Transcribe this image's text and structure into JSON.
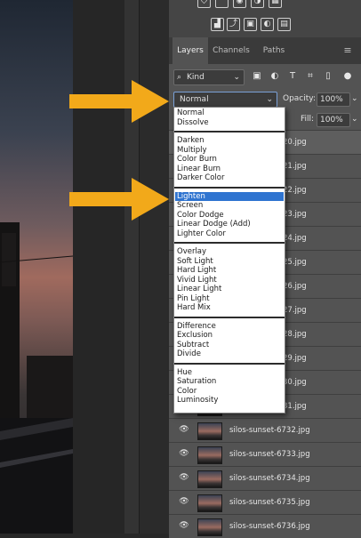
{
  "toolbar_icons": [
    {
      "name": "shape-icon",
      "glyph": "◇"
    },
    {
      "name": "warp-icon",
      "glyph": "⌒"
    },
    {
      "name": "camera-icon",
      "glyph": "◉"
    },
    {
      "name": "balance-icon",
      "glyph": "◑"
    },
    {
      "name": "grid-icon",
      "glyph": "▦"
    },
    {
      "name": "levels-icon",
      "glyph": "▟"
    },
    {
      "name": "curves-icon",
      "glyph": "⤴"
    },
    {
      "name": "mask-icon",
      "glyph": "▣"
    },
    {
      "name": "half-circle-icon",
      "glyph": "◐"
    },
    {
      "name": "table-icon",
      "glyph": "▤"
    }
  ],
  "tabs": {
    "layers": "Layers",
    "channels": "Channels",
    "paths": "Paths"
  },
  "filter": {
    "kind_label": "Kind",
    "search_glyph": "⌕",
    "chevron": "⌄",
    "icons": [
      {
        "name": "image-filter-icon",
        "glyph": "▣"
      },
      {
        "name": "adjustment-filter-icon",
        "glyph": "◐"
      },
      {
        "name": "type-filter-icon",
        "glyph": "T"
      },
      {
        "name": "shape-filter-icon",
        "glyph": "⌗"
      },
      {
        "name": "smart-object-filter-icon",
        "glyph": "▯"
      }
    ]
  },
  "blend": {
    "value": "Normal",
    "opacity_label": "Opacity:",
    "opacity_value": "100%",
    "fill_label": "Fill:",
    "fill_value": "100%"
  },
  "blend_groups": [
    [
      "Normal",
      "Dissolve"
    ],
    [
      "Darken",
      "Multiply",
      "Color Burn",
      "Linear Burn",
      "Darker Color"
    ],
    [
      "Lighten",
      "Screen",
      "Color Dodge",
      "Linear Dodge (Add)",
      "Lighter Color"
    ],
    [
      "Overlay",
      "Soft Light",
      "Hard Light",
      "Vivid Light",
      "Linear Light",
      "Pin Light",
      "Hard Mix"
    ],
    [
      "Difference",
      "Exclusion",
      "Subtract",
      "Divide"
    ],
    [
      "Hue",
      "Saturation",
      "Color",
      "Luminosity"
    ]
  ],
  "selected_option": "Lighten",
  "partial_layers": [
    "20.jpg",
    "21.jpg",
    "22.jpg",
    "23.jpg",
    "24.jpg",
    "25.jpg",
    "26.jpg",
    "27.jpg",
    "28.jpg",
    "29.jpg",
    "30.jpg",
    "31.jpg"
  ],
  "layers": [
    "silos-sunset-6732.jpg",
    "silos-sunset-6733.jpg",
    "silos-sunset-6734.jpg",
    "silos-sunset-6735.jpg",
    "silos-sunset-6736.jpg"
  ],
  "colors": {
    "accent_arrow": "#f2a91a",
    "selection": "#2f74d0",
    "panel": "#535353"
  }
}
